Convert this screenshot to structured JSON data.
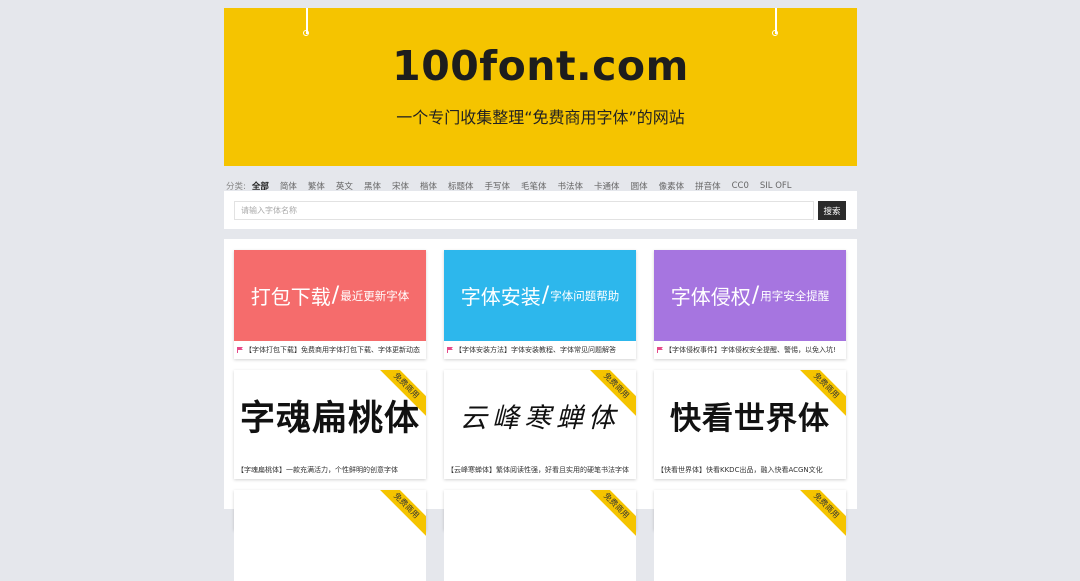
{
  "header": {
    "title": "100font.com",
    "subtitle": "一个专门收集整理“免费商用字体”的网站",
    "bg_color": "#f5c400"
  },
  "categories": {
    "label": "分类:",
    "items": [
      "全部",
      "简体",
      "繁体",
      "英文",
      "黑体",
      "宋体",
      "楷体",
      "标题体",
      "手写体",
      "毛笔体",
      "书法体",
      "卡通体",
      "圆体",
      "像素体",
      "拼音体",
      "CC0",
      "SIL OFL"
    ],
    "active": "全部"
  },
  "search": {
    "placeholder": "请输入字体名称",
    "value": "",
    "button_label": "搜索"
  },
  "feature_cards": [
    {
      "big": "打包下载",
      "slash": "/",
      "small": "最近更新字体",
      "color": "#f56c6c",
      "caption": "【字体打包下载】免费商用字体打包下载、字体更新动态",
      "flag_icon": "flag-icon",
      "flag_color": "#e64b8a"
    },
    {
      "big": "字体安装",
      "slash": "/",
      "small": "字体问题帮助",
      "color": "#2db7ec",
      "caption": "【字体安装方法】字体安装教程、字体常见问题解答",
      "flag_icon": "flag-icon",
      "flag_color": "#e64b8a"
    },
    {
      "big": "字体侵权",
      "slash": "/",
      "small": "用字安全提醒",
      "color": "#a675e0",
      "caption": "【字体侵权事件】字体侵权安全提醒、警惕，以免入坑!",
      "flag_icon": "flag-icon",
      "flag_color": "#e64b8a"
    }
  ],
  "font_cards": [
    {
      "sample": "字魂扁桃体",
      "ribbon": "免费商用",
      "caption": "【字魂扁桃体】一款充满活力，个性鲜明的创意字体"
    },
    {
      "sample": "云峰寒蝉体",
      "ribbon": "免费商用",
      "caption": "【云峰寒蝉体】繁体阅读性强，好看且实用的硬笔书法字体"
    },
    {
      "sample": "快看世界体",
      "ribbon": "免费商用",
      "caption": "【快看世界体】快看KKDC出品，融入快看ACGN文化"
    }
  ],
  "partial_cards": [
    {
      "ribbon": "免费商用"
    },
    {
      "ribbon": "免费商用"
    },
    {
      "ribbon": "免费商用"
    }
  ]
}
